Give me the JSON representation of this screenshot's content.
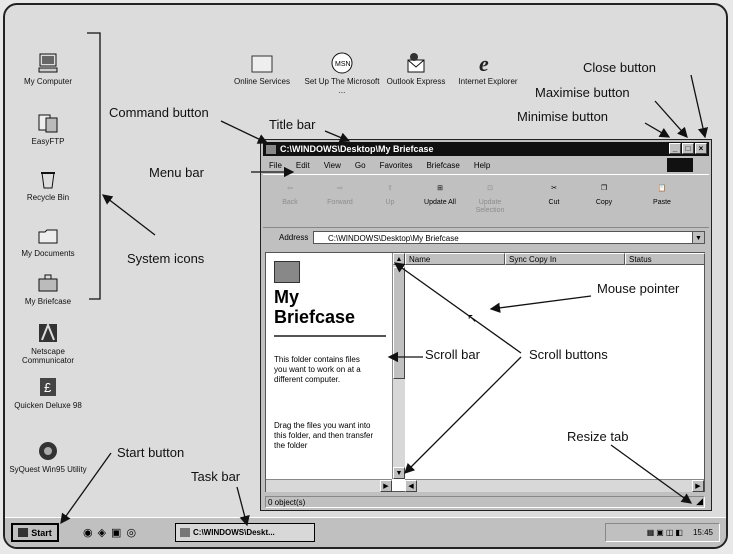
{
  "desktop_icons": [
    {
      "label": "My Computer",
      "icon": "computer-icon"
    },
    {
      "label": "EasyFTP",
      "icon": "ftp-icon"
    },
    {
      "label": "Recycle Bin",
      "icon": "recycle-bin-icon"
    },
    {
      "label": "My Documents",
      "icon": "folder-icon"
    },
    {
      "label": "My Briefcase",
      "icon": "briefcase-icon"
    },
    {
      "label": "Netscape Communicator",
      "icon": "netscape-icon"
    },
    {
      "label": "Quicken Deluxe 98",
      "icon": "quicken-icon"
    },
    {
      "label": "SyQuest Win95 Utility",
      "icon": "syquest-icon"
    }
  ],
  "top_icons": [
    {
      "label": "Online Services"
    },
    {
      "label": "Set Up The Microsoft ..."
    },
    {
      "label": "Outlook Express"
    },
    {
      "label": "Internet Explorer"
    }
  ],
  "window": {
    "title": "C:\\WINDOWS\\Desktop\\My Briefcase",
    "menu": [
      "File",
      "Edit",
      "View",
      "Go",
      "Favorites",
      "Briefcase",
      "Help"
    ],
    "toolbar": [
      "Back",
      "Forward",
      "Up",
      "Update All",
      "Update Selection",
      "Cut",
      "Copy",
      "Paste"
    ],
    "address_label": "Address",
    "address_value": "C:\\WINDOWS\\Desktop\\My Briefcase",
    "pane_title_1": "My",
    "pane_title_2": "Briefcase",
    "pane_text_1": "This folder contains files you want to work on at a different computer.",
    "pane_text_2": "Drag the files you want into this folder, and then transfer the folder",
    "columns": [
      "Name",
      "Sync Copy In",
      "Status"
    ],
    "status": "0 object(s)"
  },
  "taskbar": {
    "start_label": "Start",
    "task_label": "C:\\WINDOWS\\Deskt...",
    "clock": "15:45"
  },
  "annotations": {
    "close": "Close button",
    "maximise": "Maximise button",
    "minimise": "Minimise button",
    "command": "Command button",
    "title": "Title bar",
    "menu": "Menu bar",
    "system_icons": "System icons",
    "mouse": "Mouse pointer",
    "scroll_bar": "Scroll bar",
    "scroll_buttons": "Scroll buttons",
    "resize": "Resize tab",
    "start": "Start button",
    "task": "Task bar"
  }
}
